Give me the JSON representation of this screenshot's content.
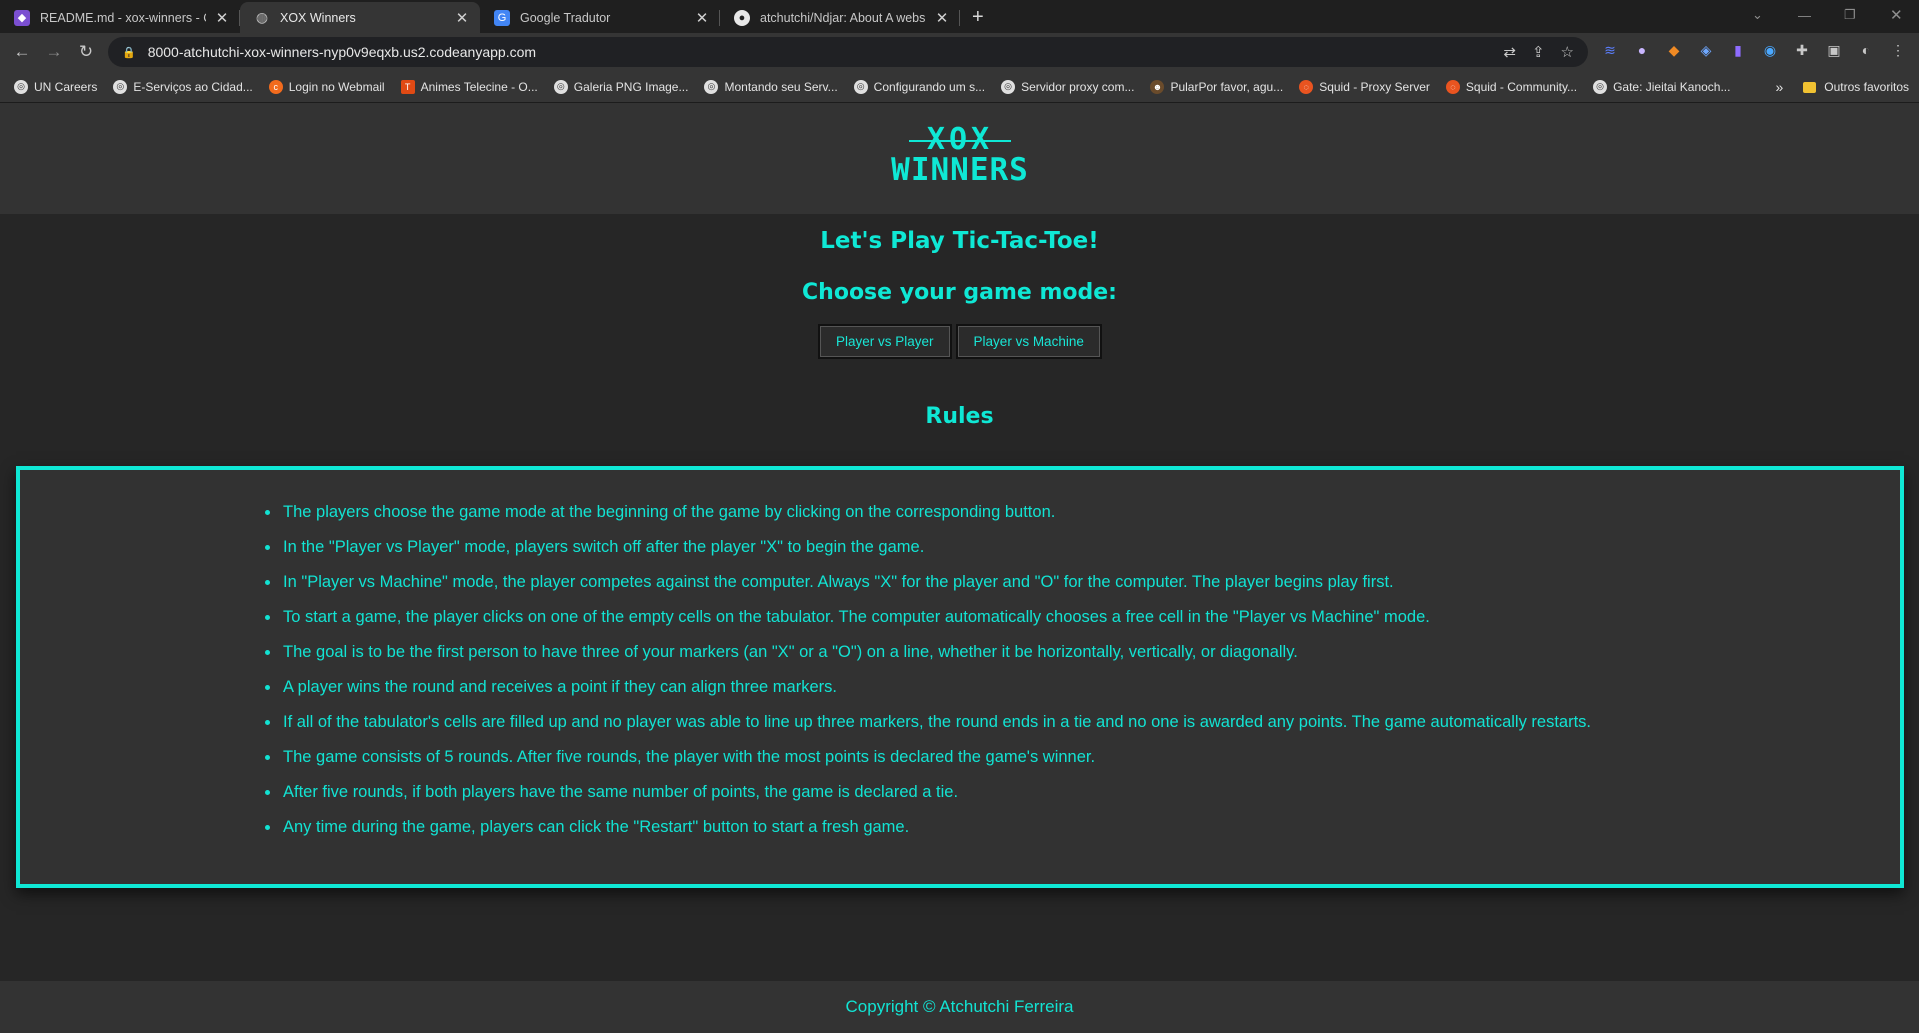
{
  "browser": {
    "tabs": [
      {
        "title": "README.md - xox-winners - Cod",
        "icon": "codeanywhere-icon",
        "active": false
      },
      {
        "title": "XOX Winners",
        "icon": "globe-icon",
        "active": true
      },
      {
        "title": "Google Tradutor",
        "icon": "translate-icon",
        "active": false
      },
      {
        "title": "atchutchi/Ndjar: About A website",
        "icon": "github-icon",
        "active": false
      }
    ],
    "new_tab": "+",
    "url": "8000-atchutchi-xox-winners-nyp0v9eqxb.us2.codeanyapp.com",
    "bookmarks": [
      "UN Careers",
      "E-Serviços ao Cidad...",
      "Login no Webmail",
      "Animes Telecine - O...",
      "Galeria PNG Image...",
      "Montando seu Serv...",
      "Configurando um s...",
      "Servidor proxy com...",
      "PularPor favor, agu...",
      "Squid - Proxy Server",
      "Squid - Community...",
      "Gate: Jieitai Kanoch..."
    ],
    "bookmarks_overflow": "»",
    "other_bookmarks": "Outros favoritos"
  },
  "header": {
    "logo_line1": "XOX",
    "logo_line2": "WINNERS"
  },
  "main": {
    "title": "Let's Play Tic-Tac-Toe!",
    "mode_heading": "Choose your game mode:",
    "modes": [
      "Player vs Player",
      "Player vs Machine"
    ],
    "rules_heading": "Rules",
    "rules": [
      "The players choose the game mode at the beginning of the game by clicking on the corresponding button.",
      "In the \"Player vs Player\" mode, players switch off after the player \"X\" to begin the game.",
      "In \"Player vs Machine\" mode, the player competes against the computer. Always \"X\" for the player and \"O\" for the computer. The player begins play first.",
      "To start a game, the player clicks on one of the empty cells on the tabulator. The computer automatically chooses a free cell in the \"Player vs Machine\" mode.",
      "The goal is to be the first person to have three of your markers (an \"X\" or a \"O\") on a line, whether it be horizontally, vertically, or diagonally.",
      "A player wins the round and receives a point if they can align three markers.",
      "If all of the tabulator's cells are filled up and no player was able to line up three markers, the round ends in a tie and no one is awarded any points. The game automatically restarts.",
      "The game consists of 5 rounds. After five rounds, the player with the most points is declared the game's winner.",
      "After five rounds, if both players have the same number of points, the game is declared a tie.",
      "Any time during the game, players can click the \"Restart\" button to start a fresh game."
    ]
  },
  "footer": {
    "copyright": "Copyright © Atchutchi Ferreira"
  },
  "colors": {
    "accent": "#0fe8d5",
    "page_bg": "#262626",
    "panel_bg": "#333333"
  }
}
